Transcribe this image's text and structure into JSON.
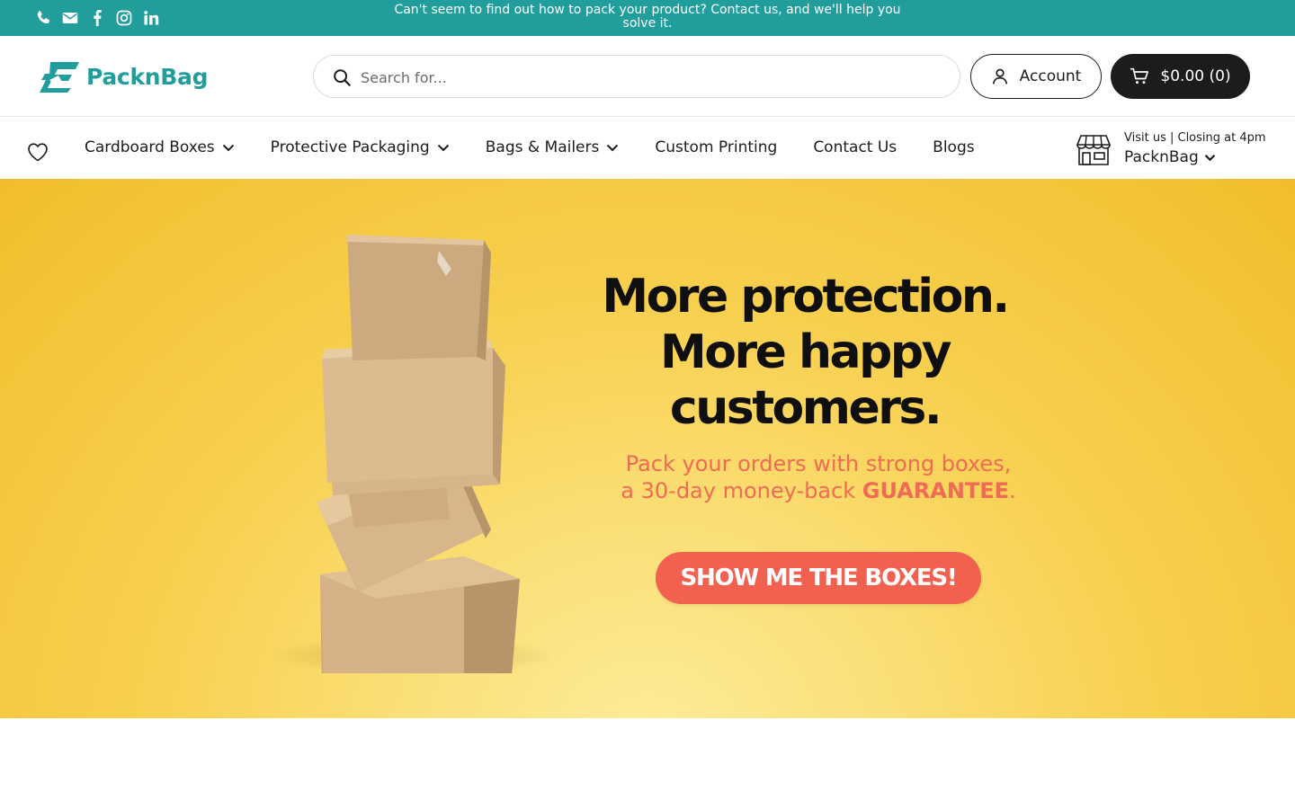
{
  "topbar": {
    "announcement": "Can't seem to find out how to pack your product? Contact us, and we'll help you solve it.",
    "social_icons": [
      "phone-icon",
      "email-icon",
      "facebook-icon",
      "instagram-icon",
      "linkedin-icon"
    ]
  },
  "header": {
    "logo_text": "PacknBag",
    "search": {
      "placeholder": "Search for...",
      "value": ""
    },
    "account_label": "Account",
    "cart_label": "$0.00 (0)"
  },
  "nav": {
    "items": [
      {
        "label": "Cardboard Boxes",
        "has_dropdown": true
      },
      {
        "label": "Protective Packaging",
        "has_dropdown": true
      },
      {
        "label": "Bags & Mailers",
        "has_dropdown": true
      },
      {
        "label": "Custom Printing",
        "has_dropdown": false
      },
      {
        "label": "Contact Us",
        "has_dropdown": false
      },
      {
        "label": "Blogs",
        "has_dropdown": false
      }
    ],
    "store": {
      "visit_text": "Visit us | Closing at 4pm",
      "name": "PacknBag"
    }
  },
  "hero": {
    "headline": [
      "More protection.",
      "More happy",
      "customers."
    ],
    "subtext": "Pack your orders with strong boxes, a 30-day money-back",
    "subtext_emphasis": "GUARANTEE",
    "subtext_end": ".",
    "cta_label": "SHOW ME THE BOXES!"
  },
  "colors": {
    "brand_teal": "#219e9c",
    "dark": "#1c1c1c",
    "hero_yellow": "#f7d04f",
    "cta_coral": "#f2604f"
  }
}
